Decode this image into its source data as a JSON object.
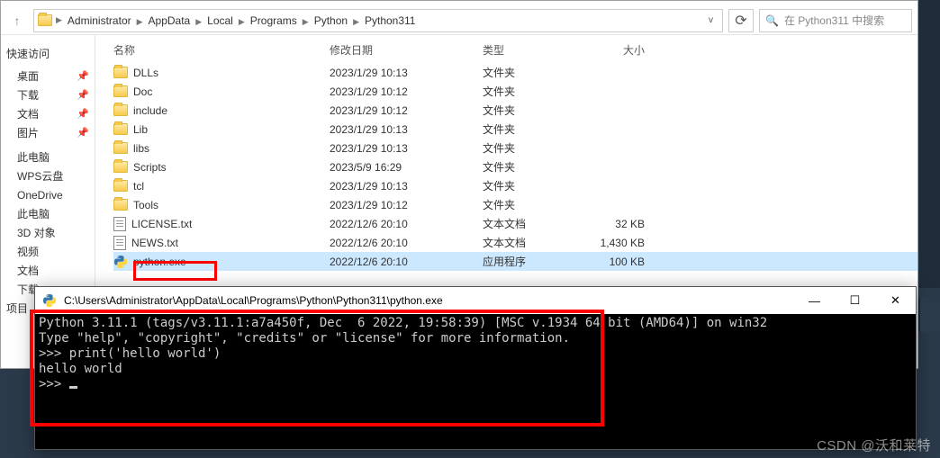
{
  "breadcrumbs": [
    "Administrator",
    "AppData",
    "Local",
    "Programs",
    "Python",
    "Python311"
  ],
  "search_placeholder": "在 Python311 中搜索",
  "sidebar": {
    "quick_access": "快速访问",
    "items_pinned": [
      "桌面",
      "下载",
      "文档",
      "图片"
    ],
    "items": [
      "此电脑",
      "WPS云盘",
      "OneDrive",
      "此电脑",
      "3D 对象",
      "视频",
      "文档",
      "下载"
    ],
    "extra": "项目"
  },
  "columns": {
    "name": "名称",
    "date": "修改日期",
    "type": "类型",
    "size": "大小"
  },
  "types": {
    "folder": "文件夹",
    "text": "文本文档",
    "app": "应用程序"
  },
  "rows": [
    {
      "icon": "folder",
      "name": "DLLs",
      "date": "2023/1/29 10:13",
      "typeKey": "folder",
      "size": ""
    },
    {
      "icon": "folder",
      "name": "Doc",
      "date": "2023/1/29 10:12",
      "typeKey": "folder",
      "size": ""
    },
    {
      "icon": "folder",
      "name": "include",
      "date": "2023/1/29 10:12",
      "typeKey": "folder",
      "size": ""
    },
    {
      "icon": "folder",
      "name": "Lib",
      "date": "2023/1/29 10:13",
      "typeKey": "folder",
      "size": ""
    },
    {
      "icon": "folder",
      "name": "libs",
      "date": "2023/1/29 10:13",
      "typeKey": "folder",
      "size": ""
    },
    {
      "icon": "folder",
      "name": "Scripts",
      "date": "2023/5/9 16:29",
      "typeKey": "folder",
      "size": ""
    },
    {
      "icon": "folder",
      "name": "tcl",
      "date": "2023/1/29 10:13",
      "typeKey": "folder",
      "size": ""
    },
    {
      "icon": "folder",
      "name": "Tools",
      "date": "2023/1/29 10:12",
      "typeKey": "folder",
      "size": ""
    },
    {
      "icon": "txt",
      "name": "LICENSE.txt",
      "date": "2022/12/6 20:10",
      "typeKey": "text",
      "size": "32 KB"
    },
    {
      "icon": "txt",
      "name": "NEWS.txt",
      "date": "2022/12/6 20:10",
      "typeKey": "text",
      "size": "1,430 KB"
    },
    {
      "icon": "exe",
      "name": "python.exe",
      "date": "2022/12/6 20:10",
      "typeKey": "app",
      "size": "100 KB",
      "selected": true
    }
  ],
  "console": {
    "title": "C:\\Users\\Administrator\\AppData\\Local\\Programs\\Python\\Python311\\python.exe",
    "lines": [
      "Python 3.11.1 (tags/v3.11.1:a7a450f, Dec  6 2022, 19:58:39) [MSC v.1934 64 bit (AMD64)] on win32",
      "Type \"help\", \"copyright\", \"credits\" or \"license\" for more information.",
      ">>> print('hello world')",
      "hello world",
      ">>> "
    ]
  },
  "watermark": "CSDN @沃和莱特"
}
